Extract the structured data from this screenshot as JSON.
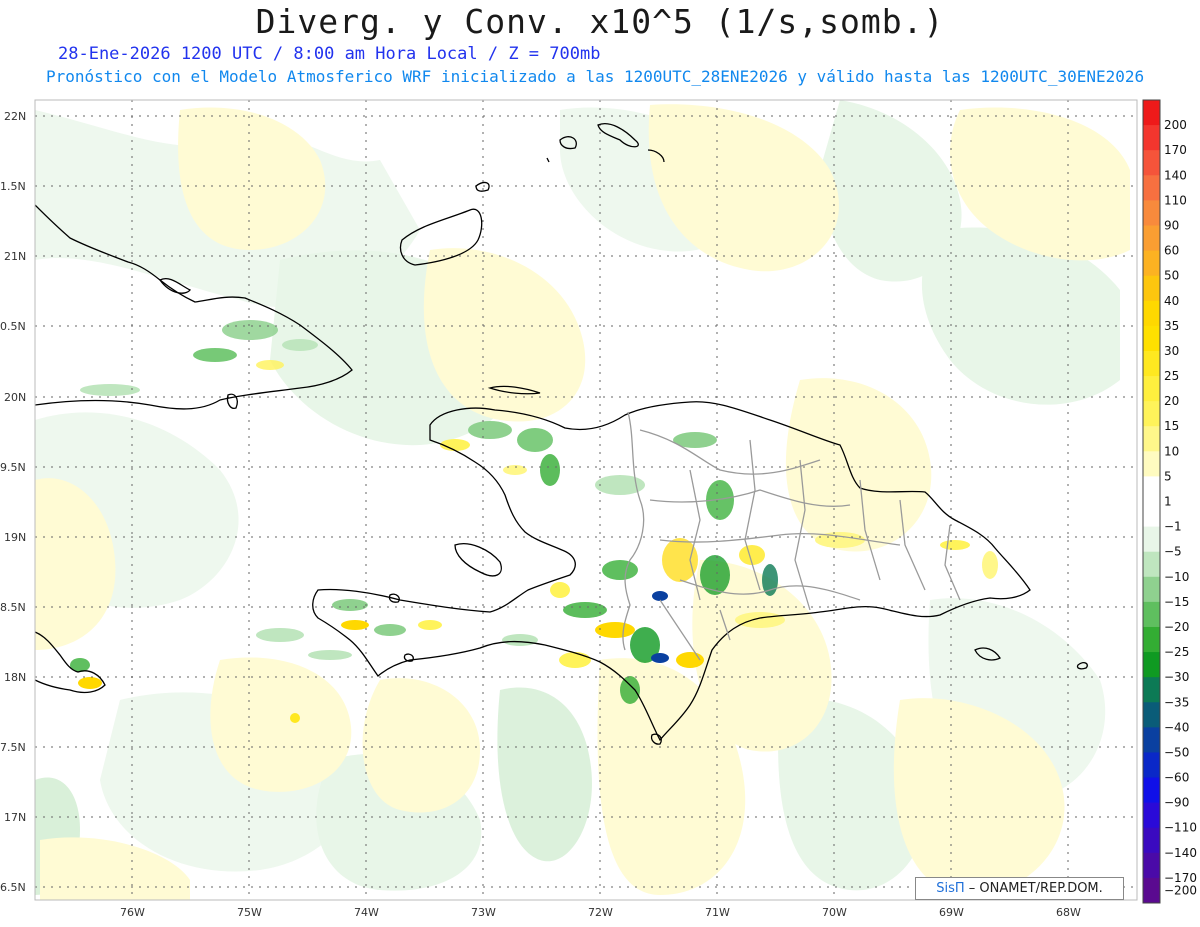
{
  "title": "Diverg. y Conv. x10^5 (1/s,somb.)",
  "subtitle_line1": "28-Ene-2026  1200 UTC / 8:00 am Hora Local / Z = 700mb",
  "subtitle_line2": "Pronóstico con el Modelo Atmosferico WRF inicializado a las 1200UTC_28ENE2026 y válido hasta las  1200UTC_30ENE2026",
  "credit": {
    "brand": "SisΠ",
    "text": "– ONAMET/REP.DOM."
  },
  "map": {
    "lat_labels": [
      "22N",
      "1.5N",
      "21N",
      "0.5N",
      "20N",
      "9.5N",
      "19N",
      "8.5N",
      "18N",
      "7.5N",
      "17N",
      "6.5N"
    ],
    "lon_labels": [
      "76W",
      "75W",
      "74W",
      "73W",
      "72W",
      "71W",
      "70W",
      "69W",
      "68W"
    ],
    "colors": {
      "land_outline": "#000000",
      "province_border": "#9a9a9a",
      "grid": "#666666"
    }
  },
  "colorbar": {
    "entries": [
      {
        "label": "200",
        "color": "#ee1a1a"
      },
      {
        "label": "170",
        "color": "#f3362e"
      },
      {
        "label": "140",
        "color": "#f5543a"
      },
      {
        "label": "110",
        "color": "#f77040"
      },
      {
        "label": "90",
        "color": "#f88a3c"
      },
      {
        "label": "60",
        "color": "#fa9e32"
      },
      {
        "label": "50",
        "color": "#fcb222"
      },
      {
        "label": "40",
        "color": "#fdc60e"
      },
      {
        "label": "35",
        "color": "#ffd800"
      },
      {
        "label": "30",
        "color": "#ffe000"
      },
      {
        "label": "25",
        "color": "#ffe820"
      },
      {
        "label": "20",
        "color": "#ffef3e"
      },
      {
        "label": "15",
        "color": "#fff35a"
      },
      {
        "label": "10",
        "color": "#fff78a"
      },
      {
        "label": "5",
        "color": "#fffbc0"
      },
      {
        "label": "1",
        "color": "#ffffff"
      },
      {
        "label": "−1",
        "color": "#ffffff"
      },
      {
        "label": "−5",
        "color": "#e8f6e8"
      },
      {
        "label": "−10",
        "color": "#bfe6bf"
      },
      {
        "label": "−15",
        "color": "#8fd18f"
      },
      {
        "label": "−20",
        "color": "#5fbf5f"
      },
      {
        "label": "−25",
        "color": "#33ad33"
      },
      {
        "label": "−30",
        "color": "#0f9a22"
      },
      {
        "label": "−35",
        "color": "#0c7a55"
      },
      {
        "label": "−40",
        "color": "#0a5c78"
      },
      {
        "label": "−50",
        "color": "#0a40a0"
      },
      {
        "label": "−60",
        "color": "#0a28c8"
      },
      {
        "label": "−90",
        "color": "#1010e8"
      },
      {
        "label": "−110",
        "color": "#2a0ad8"
      },
      {
        "label": "−140",
        "color": "#3a0ac0"
      },
      {
        "label": "−170",
        "color": "#4a0aa8"
      },
      {
        "label": "−200",
        "color": "#5a0a90"
      }
    ]
  }
}
